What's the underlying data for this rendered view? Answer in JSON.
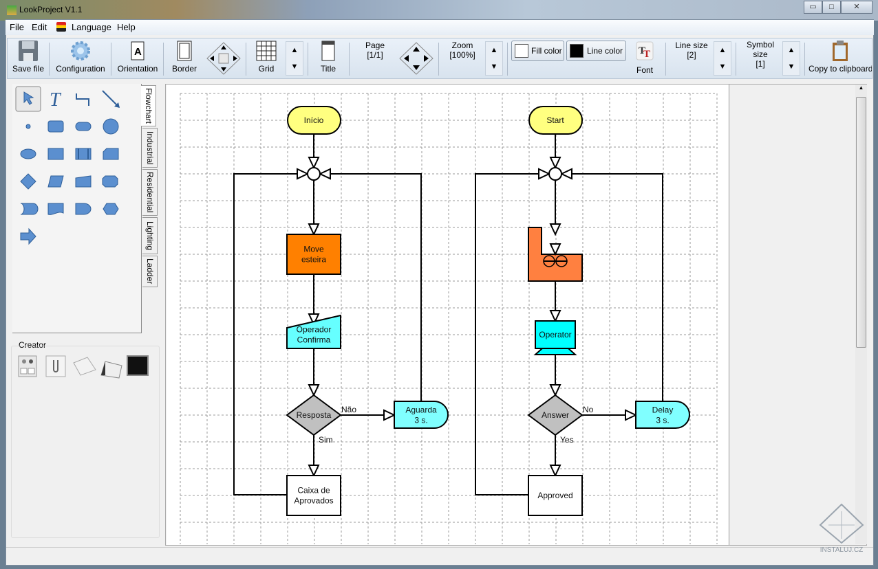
{
  "window": {
    "title": "LookProject V1.1",
    "minimize": "▭",
    "maximize": "□",
    "close": "✕"
  },
  "menu": [
    "File",
    "Edit",
    "Language",
    "Help"
  ],
  "toolbar": {
    "save": "Save file",
    "configuration": "Configuration",
    "orientation": "Orientation",
    "border": "Border",
    "grid": "Grid",
    "title": "Title",
    "page_label": "Page",
    "page_value": "[1/1]",
    "zoom_label": "Zoom",
    "zoom_value": "[100%]",
    "fill_color": "Fill color",
    "line_color": "Line color",
    "font": "Font",
    "line_size_label": "Line size",
    "line_size_value": "[2]",
    "symbol_size_label1": "Symbol",
    "symbol_size_label2": "size",
    "symbol_size_value": "[1]",
    "copy": "Copy to clipboard",
    "fill_color_hex": "#ffffff",
    "line_color_hex": "#000000"
  },
  "palette": {
    "tabs": [
      "Flowchart",
      "Industrial",
      "Residential",
      "Lighting",
      "Ladder"
    ],
    "active_tab": "Flowchart",
    "tools": [
      "select-arrow",
      "text",
      "connector",
      "line-arrow",
      "point",
      "rounded-rect",
      "pill",
      "circle",
      "ellipse",
      "rectangle",
      "predefined-process",
      "cut-corner-rect",
      "diamond",
      "parallelogram",
      "manual-input",
      "hexagon-rounded",
      "stored-data",
      "document",
      "delay",
      "hexagon",
      "arrow-right"
    ]
  },
  "creator": {
    "label": "Creator",
    "items": [
      "schematic-doc",
      "attachment",
      "notepad",
      "calendar",
      "black-screen"
    ]
  },
  "diagram": {
    "left": {
      "start": "Início",
      "process": [
        "Move",
        "esteira"
      ],
      "input": [
        "Operador",
        "Confirma"
      ],
      "decision": "Resposta",
      "no": "Não",
      "yes": "Sim",
      "delay": [
        "Aguarda",
        "3 s."
      ],
      "end": [
        "Caixa de",
        "Aprovados"
      ]
    },
    "right": {
      "start": "Start",
      "operator": "Operator",
      "decision": "Answer",
      "no": "No",
      "yes": "Yes",
      "delay": [
        "Delay",
        "3 s."
      ],
      "end": "Approved"
    },
    "colors": {
      "terminal": "#ffff80",
      "process": "#ff8000",
      "factory": "#ff8040",
      "input": "#66ffff",
      "delay": "#80ffff",
      "operator": "#00ffff",
      "decision": "#c0c0c0"
    }
  },
  "watermark": "INSTALUJ.CZ"
}
